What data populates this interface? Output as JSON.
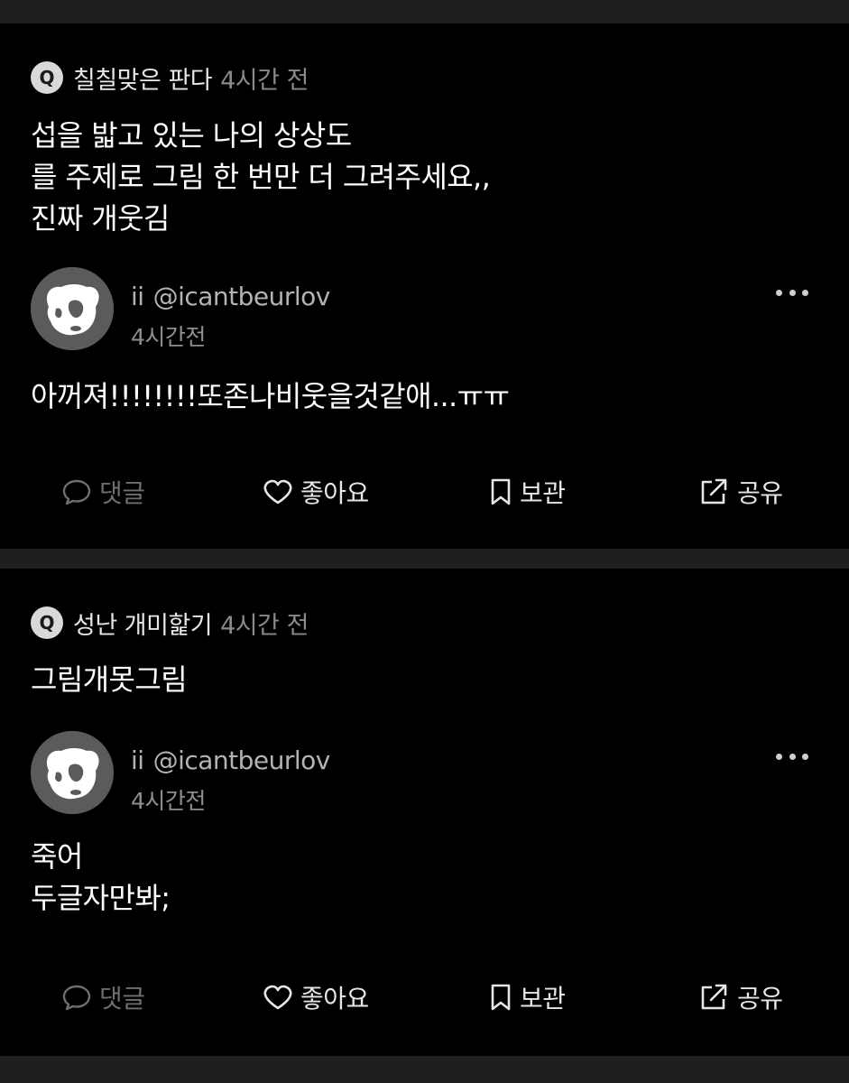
{
  "posts": [
    {
      "question": {
        "badge": "Q",
        "nickname": "칠칠맞은 판다",
        "time": "4시간 전",
        "lines": [
          "섭을 밟고 있는 나의 상상도",
          "를 주제로 그림 한 번만 더 그려주세요,,",
          "진짜 개웃김"
        ]
      },
      "author": {
        "name": "ii",
        "handle": "@icantbeurlov",
        "time": "4시간전"
      },
      "answer_lines": [
        "아꺼져!!!!!!!!또존나비웃을것같애...ㅠㅠ"
      ],
      "actions": {
        "comment": "댓글",
        "like": "좋아요",
        "save": "보관",
        "share": "공유"
      }
    },
    {
      "question": {
        "badge": "Q",
        "nickname": "성난 개미핥기",
        "time": "4시간 전",
        "lines": [
          "그림개못그림"
        ]
      },
      "author": {
        "name": "ii",
        "handle": "@icantbeurlov",
        "time": "4시간전"
      },
      "answer_lines": [
        "죽어",
        "두글자만봐;"
      ],
      "actions": {
        "comment": "댓글",
        "like": "좋아요",
        "save": "보관",
        "share": "공유"
      }
    }
  ],
  "colors": {
    "background": "#1f1f1f",
    "card": "#000000",
    "muted_text": "#8a8a8a",
    "action_disabled": "#6e6e6e"
  },
  "icons": [
    "speech-bubble-icon",
    "heart-icon",
    "bookmark-icon",
    "share-icon",
    "more-dots-icon",
    "panda-avatar"
  ]
}
